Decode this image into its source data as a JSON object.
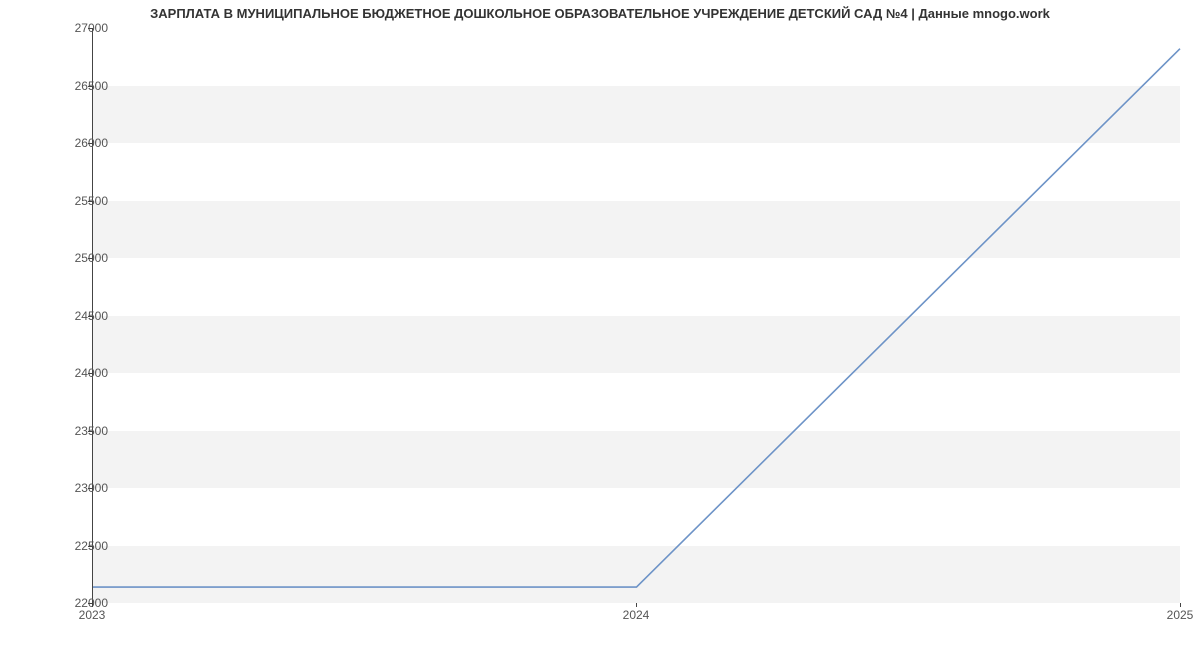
{
  "chart_data": {
    "type": "line",
    "title": "ЗАРПЛАТА В МУНИЦИПАЛЬНОЕ БЮДЖЕТНОЕ ДОШКОЛЬНОЕ ОБРАЗОВАТЕЛЬНОЕ УЧРЕЖДЕНИЕ ДЕТСКИЙ САД №4 | Данные mnogo.work",
    "xlabel": "",
    "ylabel": "",
    "x": [
      2023,
      2024,
      2025
    ],
    "values": [
      22130,
      22130,
      26820
    ],
    "x_ticks": [
      2023,
      2024,
      2025
    ],
    "y_ticks": [
      22000,
      22500,
      23000,
      23500,
      24000,
      24500,
      25000,
      25500,
      26000,
      26500,
      27000
    ],
    "xlim": [
      2023,
      2025
    ],
    "ylim": [
      22000,
      27000
    ],
    "series_color": "#6d93c7"
  }
}
